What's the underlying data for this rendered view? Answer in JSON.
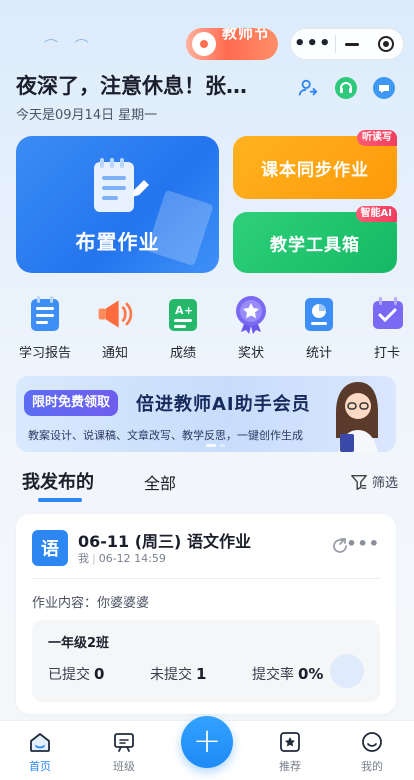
{
  "header": {
    "deco_text": "教师节",
    "capsule_more": "•••",
    "greeting": "夜深了，注意休息！张老师",
    "date_prefix": "今天是09月14日",
    "weekday": "星期一"
  },
  "cards": {
    "assign_label": "布置作业",
    "sync_label": "课本同步作业",
    "sync_badge": "听读写",
    "tools_label": "教学工具箱",
    "tools_badge": "智能AI"
  },
  "shortcuts": [
    {
      "label": "学习报告",
      "icon": "report-icon"
    },
    {
      "label": "通知",
      "icon": "megaphone-icon"
    },
    {
      "label": "成绩",
      "icon": "score-icon"
    },
    {
      "label": "奖状",
      "icon": "award-icon"
    },
    {
      "label": "统计",
      "icon": "stats-icon"
    },
    {
      "label": "打卡",
      "icon": "checkin-icon"
    }
  ],
  "banner": {
    "tag": "限时免费领取",
    "title": "倍进教师AI助手会员",
    "subtitle": "教案设计、说课稿、文章改写、教学反思，一键创作生成"
  },
  "tabs": {
    "mine": "我发布的",
    "all": "全部",
    "filter": "筛选"
  },
  "homework": {
    "subject": "语",
    "title": "06-11 (周三) 语文作业",
    "author": "我",
    "published": "06-12 14:59",
    "more": "•••",
    "content_label": "作业内容：",
    "content": "你婆婆婆",
    "class_name": "一年级2班",
    "submitted_label": "已提交",
    "submitted": "0",
    "unsubmitted_label": "未提交",
    "unsubmitted": "1",
    "rate_label": "提交率",
    "rate": "0%"
  },
  "nav": {
    "home": "首页",
    "class": "班级",
    "recommend": "推荐",
    "mine": "我的",
    "fab": "+"
  },
  "colors": {
    "primary": "#2d87f3",
    "orange": "#ff9a0a",
    "green": "#15b864",
    "badge_red": "#f23d5e"
  }
}
